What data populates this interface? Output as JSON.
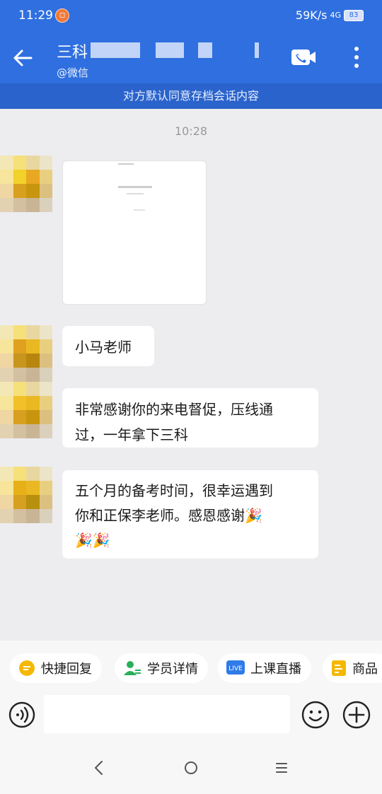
{
  "status_bar": {
    "time": "11:29",
    "network_speed": "59K/s",
    "signal": "4G",
    "battery": "83"
  },
  "header": {
    "title": "三科",
    "subtitle": "@微信"
  },
  "banner": {
    "text": "对方默认同意存档会话内容"
  },
  "chat": {
    "timestamp": "10:28",
    "messages": [
      {
        "type": "image"
      },
      {
        "type": "text",
        "text": "小马老师"
      },
      {
        "type": "text",
        "lines": [
          "非常感谢你的来电督促，压线通",
          "过，一年拿下三科"
        ]
      },
      {
        "type": "text",
        "lines": [
          "五个月的备考时间，很幸运遇到",
          "你和正保李老师。感恩感谢🎉",
          "🎉🎉"
        ]
      }
    ]
  },
  "quick_actions": [
    {
      "label": "快捷回复",
      "icon": "quick-reply-icon"
    },
    {
      "label": "学员详情",
      "icon": "student-detail-icon"
    },
    {
      "label": "上课直播",
      "icon": "live-icon"
    },
    {
      "label": "商品",
      "icon": "goods-icon"
    }
  ],
  "input": {
    "placeholder": ""
  },
  "colors": {
    "header": "#2f6fe0",
    "banner": "#2a63cb",
    "background": "#ededf0"
  }
}
